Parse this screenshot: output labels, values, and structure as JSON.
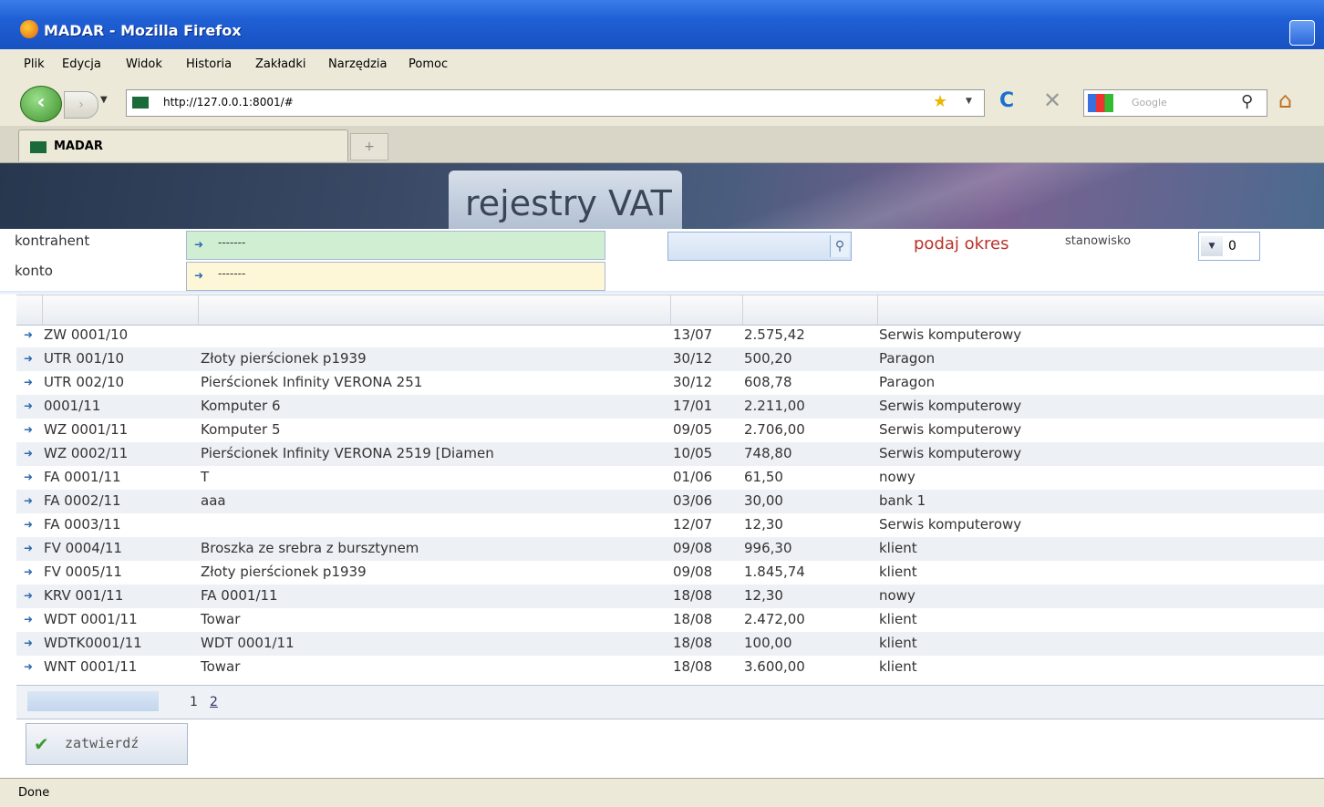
{
  "window": {
    "title": "MADAR - Mozilla Firefox"
  },
  "menu": [
    "Plik",
    "Edycja",
    "Widok",
    "Historia",
    "Zakładki",
    "Narzędzia",
    "Pomoc"
  ],
  "nav": {
    "url": "http://127.0.0.1:8001/#",
    "search_placeholder": "Google"
  },
  "tab": {
    "label": "MADAR",
    "new_tab_symbol": "+"
  },
  "banner": {
    "title": "rejestry VAT"
  },
  "filters": {
    "kontrahent_label": "kontrahent",
    "kontrahent_value": "-------",
    "konto_label": "konto",
    "konto_value": "-------",
    "period_label": "podaj okres",
    "stanowisko_label": "stanowisko",
    "stanowisko_value": "0"
  },
  "colors": {
    "kontrahent_bg": "#cfeed2",
    "konto_bg": "#fdf7d8",
    "period": "#b8322a"
  },
  "table": {
    "rows": [
      {
        "doc": "ZW 0001/10",
        "desc": "",
        "date": "13/07",
        "amount": "2.575,42",
        "type": "Serwis komputerowy"
      },
      {
        "doc": "UTR 001/10",
        "desc": "Złoty pierścionek p1939",
        "date": "30/12",
        "amount": "500,20",
        "type": "Paragon"
      },
      {
        "doc": "UTR 002/10",
        "desc": "Pierścionek Infinity VERONA 251",
        "date": "30/12",
        "amount": "608,78",
        "type": "Paragon"
      },
      {
        "doc": "0001/11",
        "desc": "Komputer 6",
        "date": "17/01",
        "amount": "2.211,00",
        "type": "Serwis komputerowy"
      },
      {
        "doc": "WZ 0001/11",
        "desc": "Komputer 5",
        "date": "09/05",
        "amount": "2.706,00",
        "type": "Serwis komputerowy"
      },
      {
        "doc": "WZ 0002/11",
        "desc": "Pierścionek Infinity VERONA 2519 [Diamen",
        "date": "10/05",
        "amount": "748,80",
        "type": "Serwis komputerowy"
      },
      {
        "doc": "FA 0001/11",
        "desc": "T",
        "date": "01/06",
        "amount": "61,50",
        "type": "nowy"
      },
      {
        "doc": "FA 0002/11",
        "desc": "aaa",
        "date": "03/06",
        "amount": "30,00",
        "type": "bank 1"
      },
      {
        "doc": "FA 0003/11",
        "desc": "",
        "date": "12/07",
        "amount": "12,30",
        "type": "Serwis komputerowy"
      },
      {
        "doc": "FV 0004/11",
        "desc": "Broszka ze srebra z bursztynem",
        "date": "09/08",
        "amount": "996,30",
        "type": "klient"
      },
      {
        "doc": "FV 0005/11",
        "desc": "Złoty pierścionek p1939",
        "date": "09/08",
        "amount": "1.845,74",
        "type": "klient"
      },
      {
        "doc": "KRV 001/11",
        "desc": "FA 0001/11",
        "date": "18/08",
        "amount": "12,30",
        "type": "nowy"
      },
      {
        "doc": "WDT 0001/11",
        "desc": "Towar",
        "date": "18/08",
        "amount": "2.472,00",
        "type": "klient"
      },
      {
        "doc": "WDTK0001/11",
        "desc": "WDT 0001/11",
        "date": "18/08",
        "amount": "100,00",
        "type": "klient"
      },
      {
        "doc": "WNT 0001/11",
        "desc": "Towar",
        "date": "18/08",
        "amount": "3.600,00",
        "type": "klient"
      }
    ]
  },
  "pager": {
    "page1": "1",
    "page2": "2"
  },
  "confirm_label": "zatwierdź",
  "status": "Done"
}
